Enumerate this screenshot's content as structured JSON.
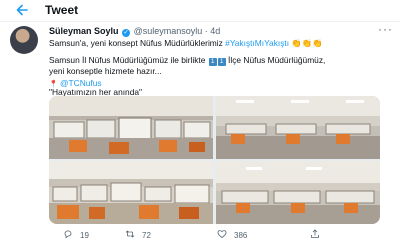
{
  "header": {
    "title": "Tweet"
  },
  "tweet": {
    "author": {
      "display_name": "Süleyman Soylu",
      "handle": "@suleymansoylu",
      "time": "4d"
    },
    "line1": {
      "prefix": "Samsun'a, yeni konsept Nüfus Müdürlüklerimiz ",
      "hashtag": "#YakıştıMıYakıştı",
      "emoji": "👏👏👏"
    },
    "line2": {
      "prefix": "Samsun İl Nüfus Müdürlüğümüz ile birlikte ",
      "badge_a": "1",
      "badge_b": "1",
      "suffix": " İlçe Nüfus Müdürlüğümüz,"
    },
    "line3": "yeni konseptle hizmete hazır...",
    "line4": {
      "pin": "📍",
      "mention": "@TCNufus"
    },
    "line5": "\"Hayatımızın her anında\"",
    "actions": {
      "replies": "19",
      "retweets": "72",
      "likes": "386"
    }
  },
  "colors": {
    "accent": "#1d9bf0",
    "muted": "#536471",
    "office_orange": "#e07a2e"
  },
  "icons": [
    "back-arrow-icon",
    "verified-badge-icon",
    "more-icon",
    "reply-icon",
    "retweet-icon",
    "like-icon",
    "share-icon"
  ]
}
